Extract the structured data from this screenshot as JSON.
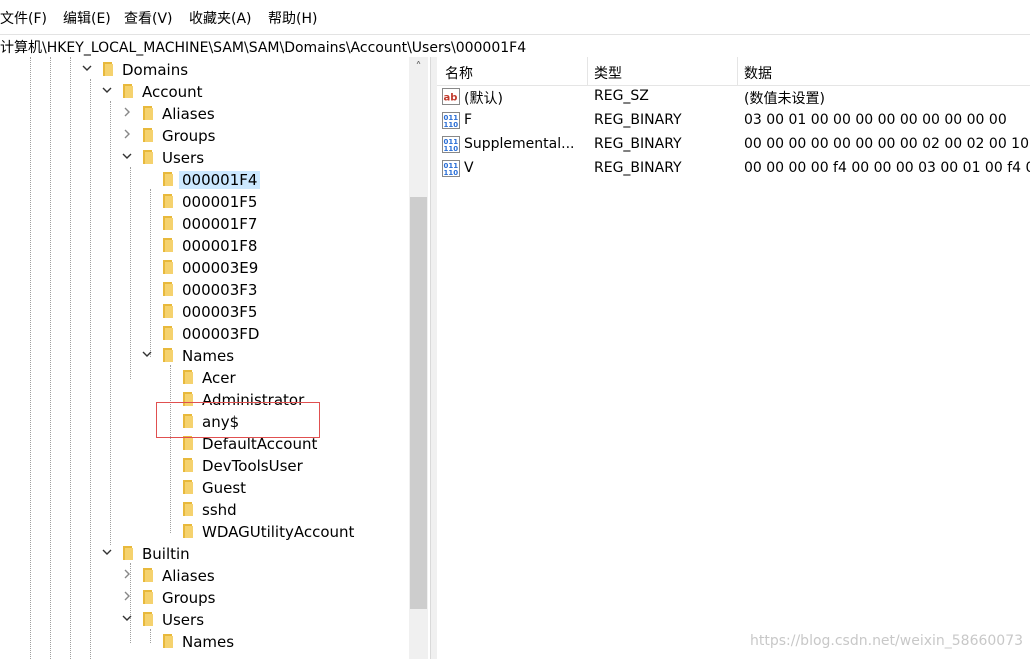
{
  "menu": [
    "文件(F)",
    "编辑(E)",
    "查看(V)",
    "收藏夹(A)",
    "帮助(H)"
  ],
  "address": "计算机\\HKEY_LOCAL_MACHINE\\SAM\\SAM\\Domains\\Account\\Users\\000001F4",
  "tree": [
    {
      "label": "Domains",
      "expanded": true
    },
    {
      "label": "Account",
      "expanded": true
    },
    {
      "label": "Aliases",
      "expanded": false
    },
    {
      "label": "Groups",
      "expanded": false
    },
    {
      "label": "Users",
      "expanded": true
    },
    {
      "label": "000001F4",
      "selected": true
    },
    {
      "label": "000001F5"
    },
    {
      "label": "000001F7"
    },
    {
      "label": "000001F8"
    },
    {
      "label": "000003E9"
    },
    {
      "label": "000003F3"
    },
    {
      "label": "000003F5"
    },
    {
      "label": "000003FD"
    },
    {
      "label": "Names",
      "expanded": true
    },
    {
      "label": "Acer"
    },
    {
      "label": "Administrator"
    },
    {
      "label": "any$",
      "highlighted": true
    },
    {
      "label": "DefaultAccount"
    },
    {
      "label": "DevToolsUser"
    },
    {
      "label": "Guest"
    },
    {
      "label": "sshd"
    },
    {
      "label": "WDAGUtilityAccount"
    },
    {
      "label": "Builtin",
      "expanded": true
    },
    {
      "label": "Aliases",
      "expanded": false
    },
    {
      "label": "Groups",
      "expanded": false
    },
    {
      "label": "Users",
      "expanded": true
    },
    {
      "label": "Names"
    }
  ],
  "columns": [
    "名称",
    "类型",
    "数据"
  ],
  "values": [
    {
      "name": "(默认)",
      "type": "REG_SZ",
      "data": "(数值未设置)",
      "icon": "string-value-icon"
    },
    {
      "name": "F",
      "type": "REG_BINARY",
      "data": "03 00 01 00 00 00 00 00 00 00 00 00",
      "icon": "binary-value-icon"
    },
    {
      "name": "Supplemental...",
      "type": "REG_BINARY",
      "data": "00 00 00 00 00 00 00 00 02 00 02 00 10",
      "icon": "binary-value-icon"
    },
    {
      "name": "V",
      "type": "REG_BINARY",
      "data": "00 00 00 00 f4 00 00 00 03 00 01 00 f4 0",
      "icon": "binary-value-icon"
    }
  ],
  "colors": {
    "selection": "#cce8ff",
    "folder": "#e8b93c",
    "highlight_box": "#e05050",
    "accent_blue": "#2b6fd6"
  },
  "watermark": "https://blog.csdn.net/weixin_58660073"
}
